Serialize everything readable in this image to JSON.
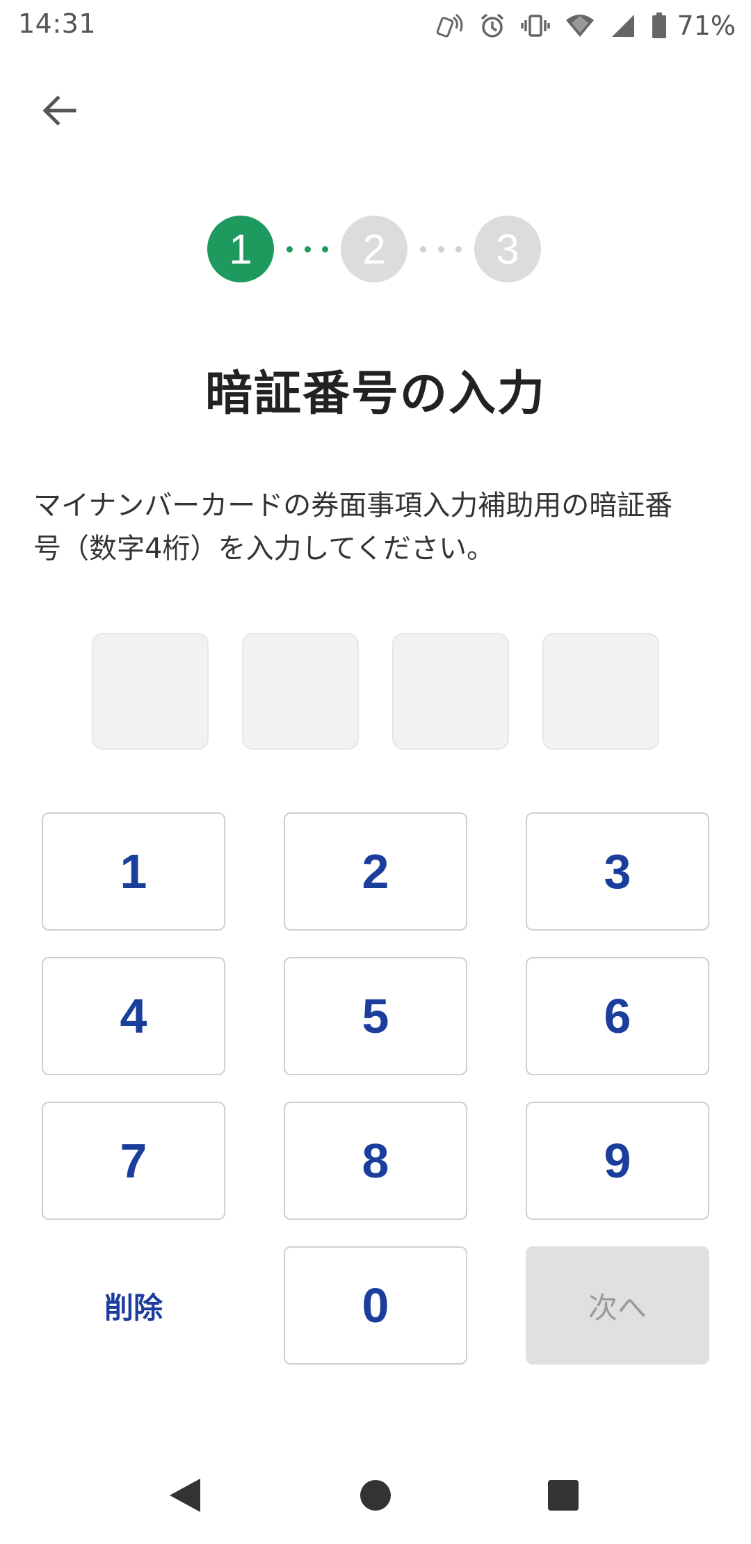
{
  "status_bar": {
    "time": "14:31",
    "battery_percent": "71%",
    "icons": [
      "nfc-icon",
      "alarm-icon",
      "vibrate-icon",
      "wifi-icon",
      "signal-icon",
      "battery-icon"
    ]
  },
  "header": {
    "back_icon": "arrow-left-icon"
  },
  "stepper": {
    "steps": [
      "1",
      "2",
      "3"
    ],
    "current": 1,
    "active_color": "#1f9a5f",
    "inactive_color": "#dcdcdc"
  },
  "page": {
    "title": "暗証番号の入力",
    "description_line1": "マイナンバーカードの券面事項入力補助用の暗証番",
    "description_line2": "号（数字4桁）を入力してください。"
  },
  "pin": {
    "length": 4,
    "entered": [
      "",
      "",
      "",
      ""
    ]
  },
  "keypad": {
    "digits": [
      "1",
      "2",
      "3",
      "4",
      "5",
      "6",
      "7",
      "8",
      "9",
      "0"
    ],
    "delete_label": "削除",
    "next_label": "次へ",
    "key_color": "#1b3d9c"
  },
  "nav_bar": {
    "buttons": [
      "back-triangle-icon",
      "home-circle-icon",
      "recents-square-icon"
    ]
  }
}
